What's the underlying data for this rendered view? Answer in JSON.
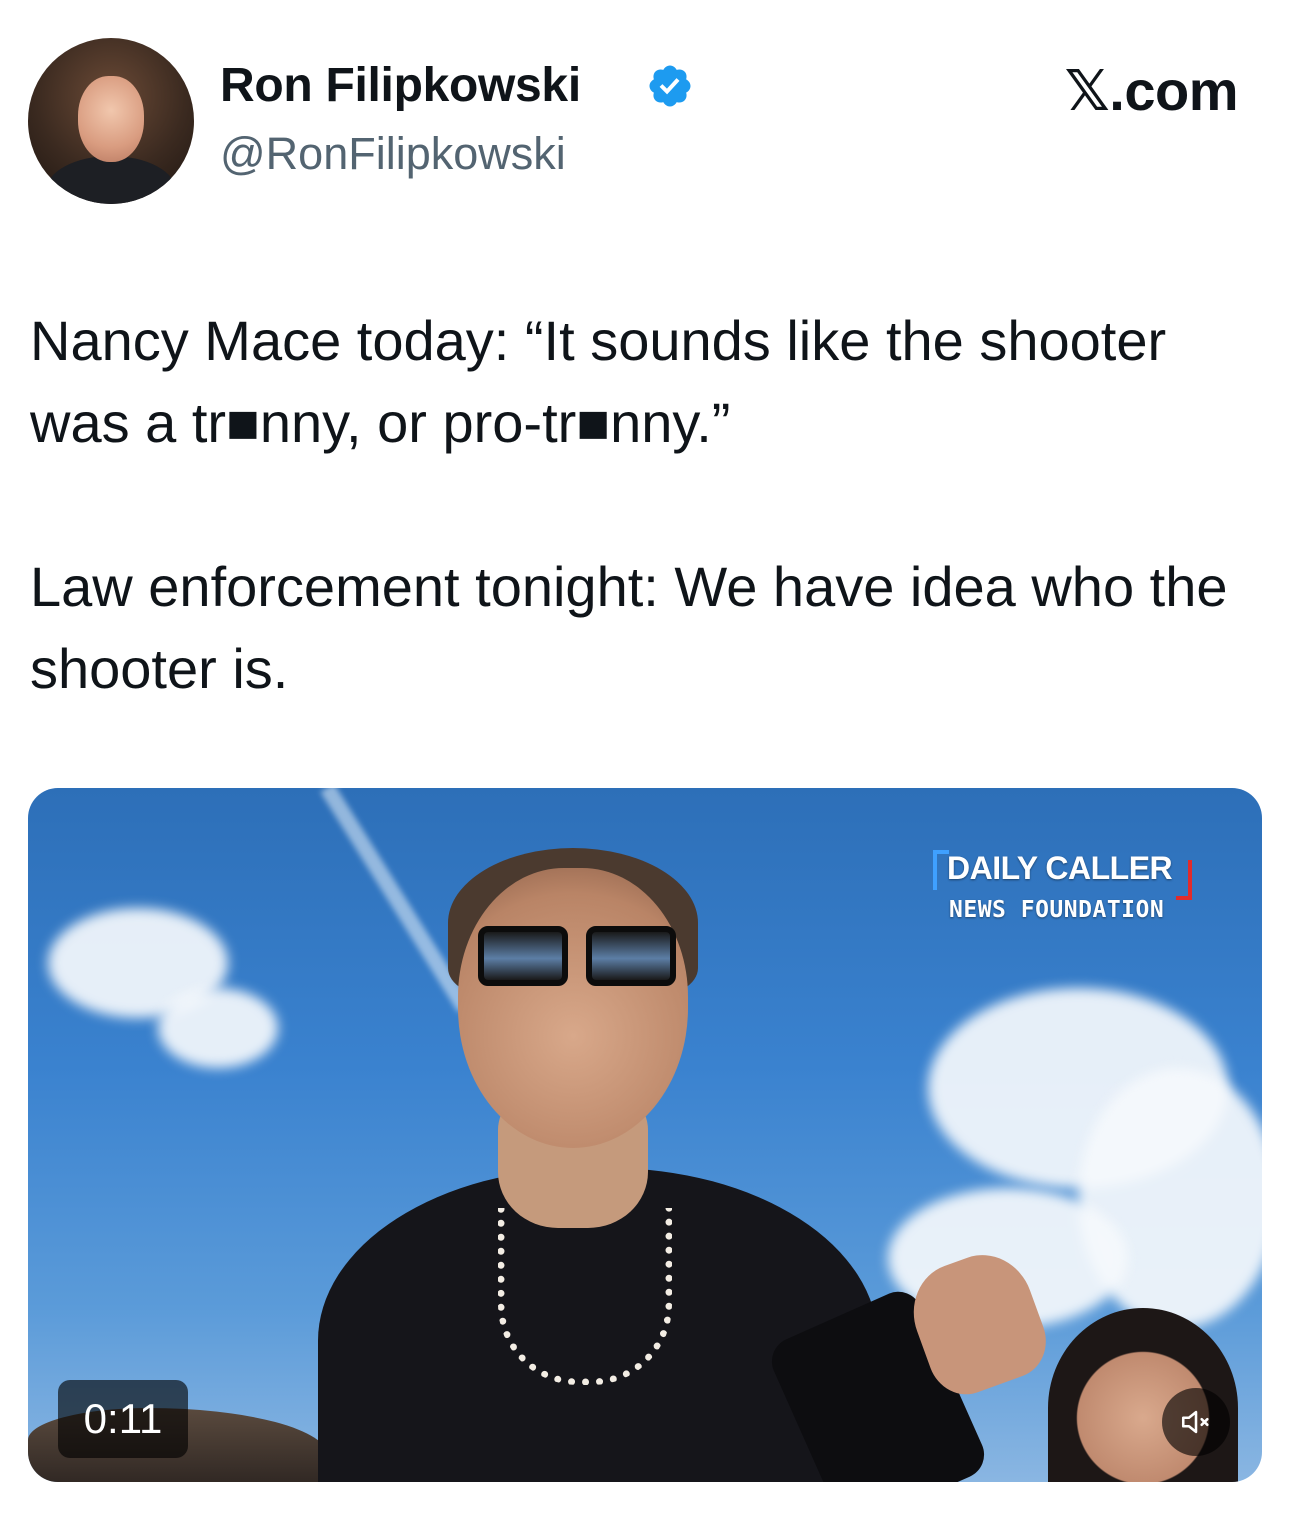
{
  "author": {
    "display_name": "Ron Filipkowski",
    "handle": "@RonFilipkowski",
    "verified_icon": "verified-badge-icon",
    "verified_color": "#1d9bf0"
  },
  "brand": {
    "label": "𝕏.com"
  },
  "tweet": {
    "paragraph_1": "Nancy Mace today: “It sounds like the shooter was a tr■nny, or pro-tr■nny.”",
    "paragraph_2": "Law enforcement tonight: We have idea who the shooter is."
  },
  "media": {
    "type": "video",
    "duration": "0:11",
    "watermark_line1": "DAILY CALLER",
    "watermark_line2": "NEWS FOUNDATION",
    "mute_icon": "speaker-muted-icon"
  }
}
